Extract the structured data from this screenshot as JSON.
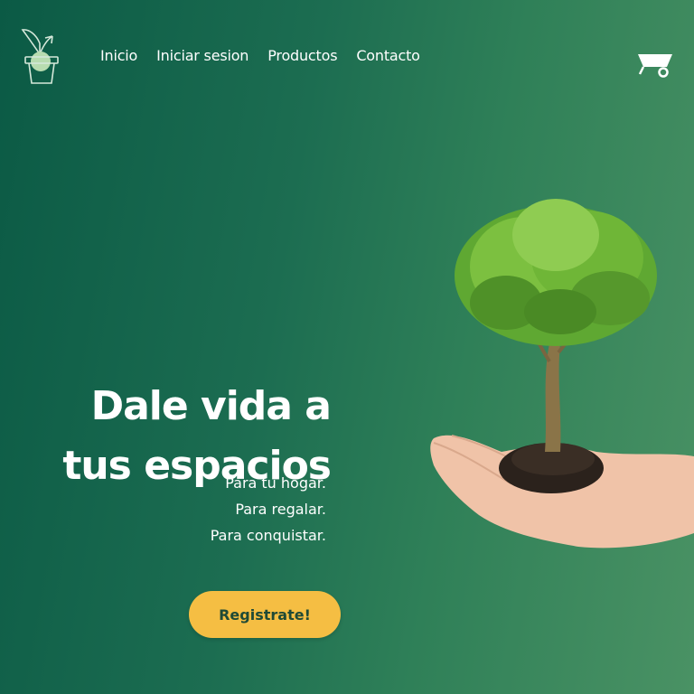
{
  "nav": {
    "items": [
      {
        "label": "Inicio"
      },
      {
        "label": "Iniciar sesion"
      },
      {
        "label": "Productos"
      },
      {
        "label": "Contacto"
      }
    ]
  },
  "icons": {
    "logo": "plant-pot-logo-icon",
    "cart": "wheelbarrow-cart-icon"
  },
  "hero": {
    "title_line1": "Dale vida a",
    "title_line2": "tus espacios",
    "taglines": [
      "Para tu hogar.",
      "Para regalar.",
      "Para conquistar."
    ],
    "cta_label": "Registrate!",
    "image": "tree-in-hand-image"
  },
  "colors": {
    "bg_dark": "#0b5a45",
    "bg_light": "#4a9264",
    "cta_bg": "#f5be43",
    "cta_text": "#1f4a36"
  }
}
